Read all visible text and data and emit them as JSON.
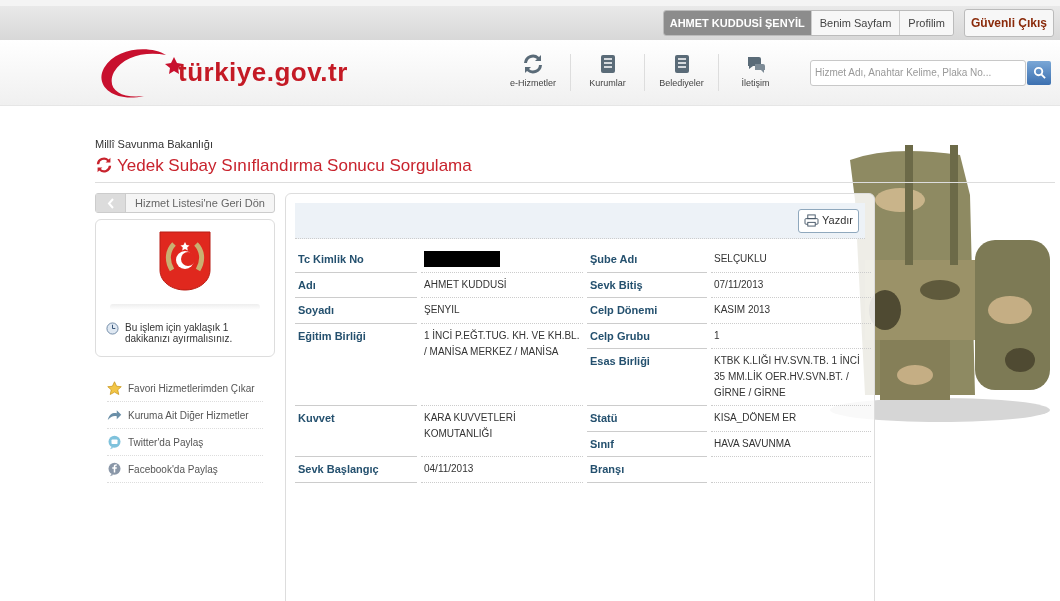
{
  "user_nav": {
    "user": "AHMET KUDDUSİ ŞENYİL",
    "links": [
      "Benim Sayfam",
      "Profilim"
    ],
    "logout": "Güvenli Çıkış"
  },
  "logo": {
    "text": "türkiye.gov.tr"
  },
  "main_nav": [
    {
      "kind": "refresh",
      "label": "e-Hizmetler"
    },
    {
      "kind": "book",
      "label": "Kurumlar"
    },
    {
      "kind": "book",
      "label": "Belediyeler"
    },
    {
      "kind": "chat",
      "label": "İletişim"
    }
  ],
  "search": {
    "placeholder": "Hizmet Adı, Anahtar Kelime, Plaka No..."
  },
  "breadcrumb": "Millî Savunma Bakanlığı",
  "page_title": "Yedek Subay Sınıflandırma Sonucu Sorgulama",
  "back_button": "Hizmet Listesi'ne Geri Dön",
  "info_note": "Bu işlem için yaklaşık 1 dakikanızı ayırmalısınız.",
  "side_links": [
    {
      "kind": "star",
      "label": "Favori Hizmetlerimden Çıkar"
    },
    {
      "kind": "arrow",
      "label": "Kuruma Ait Diğer Hizmetler"
    },
    {
      "kind": "twitter",
      "label": "Twitter'da Paylaş"
    },
    {
      "kind": "facebook",
      "label": "Facebook'da Paylaş"
    }
  ],
  "print_button": "Yazdır",
  "rows": [
    {
      "left": {
        "label": "Tc Kimlik No",
        "kind": "redacted"
      },
      "right": {
        "label": "Şube Adı",
        "value": "SELÇUKLU"
      }
    },
    {
      "left": {
        "label": "Adı",
        "kind": "text",
        "value": "AHMET KUDDUSİ"
      },
      "right": {
        "label": "Sevk Bitiş",
        "value": "07/11/2013"
      }
    },
    {
      "left": {
        "label": "Soyadı",
        "kind": "text",
        "value": "ŞENYIL"
      },
      "right": {
        "label": "Celp Dönemi",
        "value": "KASIM 2013"
      }
    },
    {
      "left": {
        "label": "Eğitim Birliği",
        "kind": "text",
        "value": "1 İNCİ P.EĞT.TUG. KH. VE KH.BL. / MANİSA MERKEZ / MANİSA"
      },
      "right": {
        "label": "Celp Grubu",
        "value": "1"
      }
    },
    {
      "right": {
        "label": "Esas Birliği",
        "value": "KTBK K.LIĞI HV.SVN.TB. 1 İNCİ 35 MM.LİK OER.HV.SVN.BT. / GİRNE / GİRNE"
      }
    },
    {
      "left": {
        "label": "Kuvvet",
        "kind": "text",
        "value": "KARA KUVVETLERİ KOMUTANLIĞI"
      },
      "right": {
        "label": "Statü",
        "value": "KISA_DÖNEM ER"
      }
    },
    {
      "right": {
        "label": "Sınıf",
        "value": "HAVA SAVUNMA"
      }
    },
    {
      "left": {
        "label": "Sevk Başlangıç",
        "kind": "text",
        "value": "04/11/2013"
      },
      "right": {
        "label": "Branşı"
      }
    }
  ]
}
